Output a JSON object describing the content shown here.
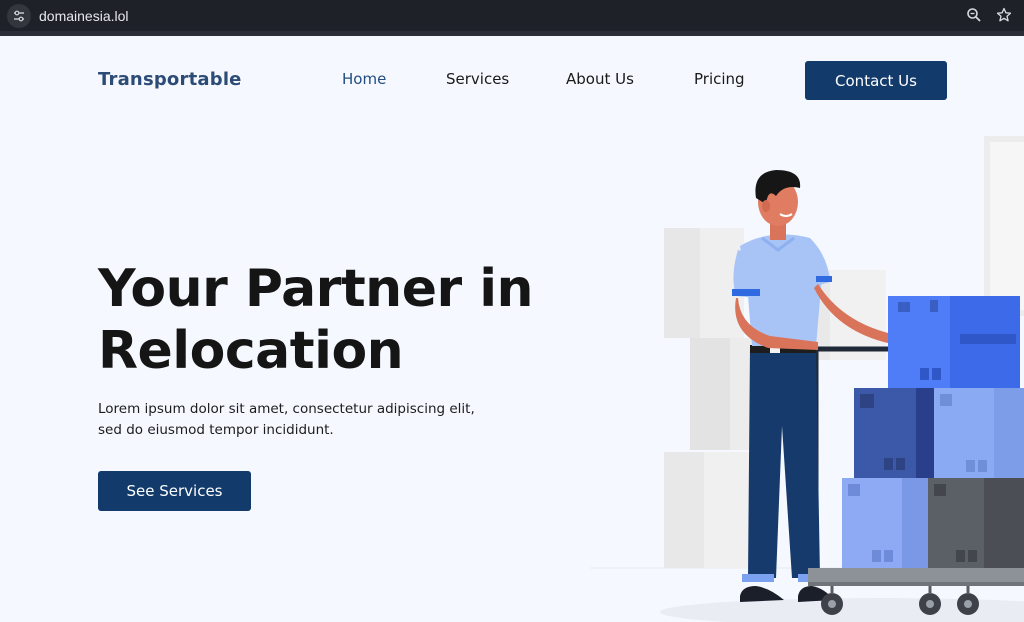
{
  "browser": {
    "url": "domainesia.lol",
    "icons": [
      "site-settings-icon",
      "zoom-icon",
      "bookmark-star-icon"
    ]
  },
  "header": {
    "brand": "Transportable",
    "nav": [
      {
        "label": "Home",
        "active": true
      },
      {
        "label": "Services",
        "active": false
      },
      {
        "label": "About Us",
        "active": false
      },
      {
        "label": "Pricing",
        "active": false
      }
    ],
    "contact_label": "Contact Us"
  },
  "hero": {
    "title_line1": "Your Partner in",
    "title_line2": "Relocation",
    "subtitle_line1": "Lorem ipsum dolor sit amet, consectetur adipiscing elit,",
    "subtitle_line2": "sed do eiusmod tempor incididunt.",
    "cta_label": "See Services"
  },
  "colors": {
    "brand": "#2c4b75",
    "primary_button": "#123a6b",
    "page_background": "#f5f9ff",
    "browser_bar": "#1e2128"
  }
}
